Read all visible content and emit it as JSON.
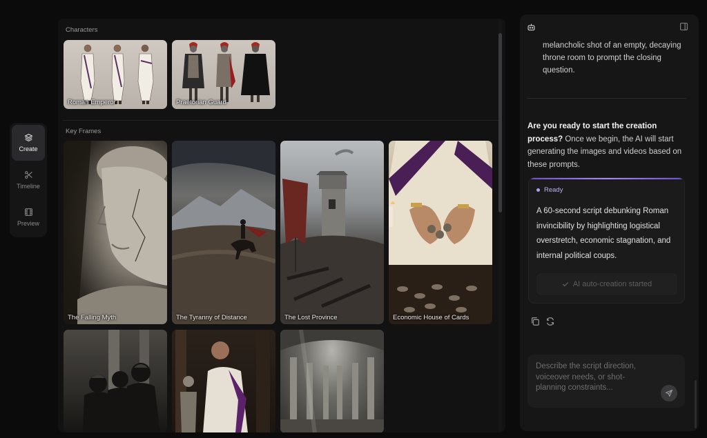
{
  "nav": {
    "items": [
      {
        "label": "Create",
        "icon": "layers-icon",
        "active": true
      },
      {
        "label": "Timeline",
        "icon": "scissors-icon",
        "active": false
      },
      {
        "label": "Preview",
        "icon": "film-icon",
        "active": false
      }
    ]
  },
  "gallery": {
    "characters_title": "Characters",
    "characters": [
      {
        "label": "Roman Emperor"
      },
      {
        "label": "Praetorian Guard"
      }
    ],
    "keyframes_title": "Key Frames",
    "keyframes": [
      {
        "label": "The Falling Myth"
      },
      {
        "label": "The Tyranny of Distance"
      },
      {
        "label": "The Lost Province"
      },
      {
        "label": "Economic House of Cards"
      },
      {
        "label": ""
      },
      {
        "label": ""
      },
      {
        "label": ""
      }
    ]
  },
  "chat": {
    "previous_text": "melancholic shot of an empty, decaying throne room to prompt the closing question.",
    "question_bold": "Are you ready to start the creation process?",
    "question_rest": " Once we begin, the AI will start generating the images and videos based on these prompts.",
    "ready_label": "Ready",
    "ready_text": "A 60-second script debunking Roman invincibility by highlighting logistical overstretch, economic stagnation, and internal political coups.",
    "auto_button": "AI auto-creation started",
    "input_placeholder": "Describe the script direction, voiceover needs, or shot-planning constraints...",
    "input_value": ""
  },
  "colors": {
    "accent": "#a98bf5",
    "background": "#0b0b0c",
    "panel": "#161617"
  }
}
